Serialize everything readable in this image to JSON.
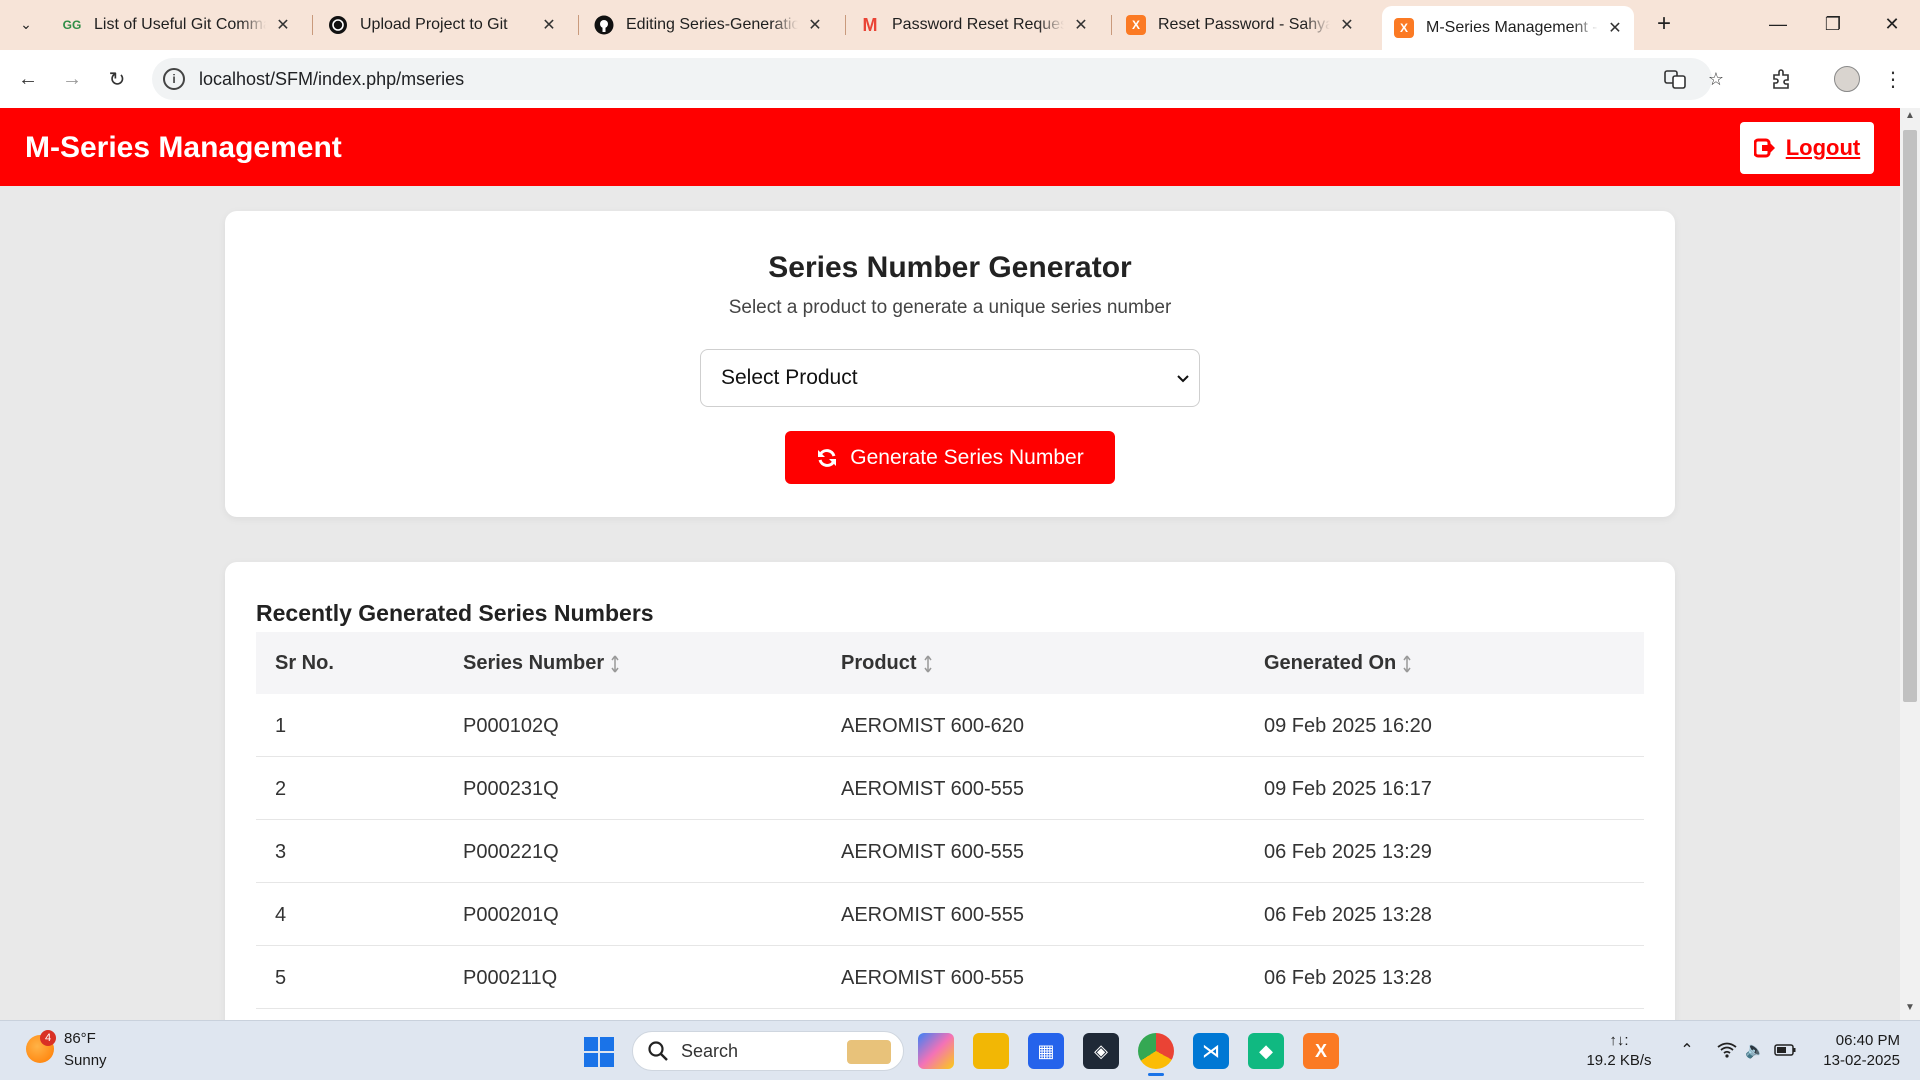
{
  "browser": {
    "tabs": [
      {
        "title": "List of Useful Git Commands",
        "icon": "geeksforgeeks-icon",
        "color": "#2f8d46"
      },
      {
        "title": "Upload Project to Git",
        "icon": "chatgpt-icon",
        "color": "#000000"
      },
      {
        "title": "Editing Series-Generation-",
        "icon": "github-icon",
        "color": "#000000"
      },
      {
        "title": "Password Reset Request - ",
        "icon": "gmail-icon",
        "color": "#ea4335"
      },
      {
        "title": "Reset Password - Sahyadri",
        "icon": "xampp-icon",
        "color": "#fb7a24"
      },
      {
        "title": "M-Series Management - S",
        "icon": "xampp-icon",
        "color": "#fb7a24",
        "active": true
      }
    ],
    "url": "localhost/SFM/index.php/mseries"
  },
  "app": {
    "brand": "M-Series Management",
    "logout_label": "Logout",
    "accent": "#ff0000"
  },
  "generator": {
    "title": "Series Number Generator",
    "subtitle": "Select a product to generate a unique series number",
    "select_value": "Select Product",
    "button_label": "Generate Series Number"
  },
  "recent": {
    "title": "Recently Generated Series Numbers",
    "columns": [
      "Sr No.",
      "Series Number",
      "Product",
      "Generated On"
    ],
    "rows": [
      {
        "sr": "1",
        "series": "P000102Q",
        "product": "AEROMIST 600-620",
        "date": "09 Feb 2025 16:20"
      },
      {
        "sr": "2",
        "series": "P000231Q",
        "product": "AEROMIST 600-555",
        "date": "09 Feb 2025 16:17"
      },
      {
        "sr": "3",
        "series": "P000221Q",
        "product": "AEROMIST 600-555",
        "date": "06 Feb 2025 13:29"
      },
      {
        "sr": "4",
        "series": "P000201Q",
        "product": "AEROMIST 600-555",
        "date": "06 Feb 2025 13:28"
      },
      {
        "sr": "5",
        "series": "P000211Q",
        "product": "AEROMIST 600-555",
        "date": "06 Feb 2025 13:28"
      }
    ]
  },
  "taskbar": {
    "weather": {
      "temp": "86°F",
      "condition": "Sunny",
      "badge": "4"
    },
    "search_label": "Search",
    "network": {
      "arrows": "↑↓:",
      "speed": "19.2 KB/s"
    },
    "time": "06:40 PM",
    "date": "13-02-2025"
  }
}
